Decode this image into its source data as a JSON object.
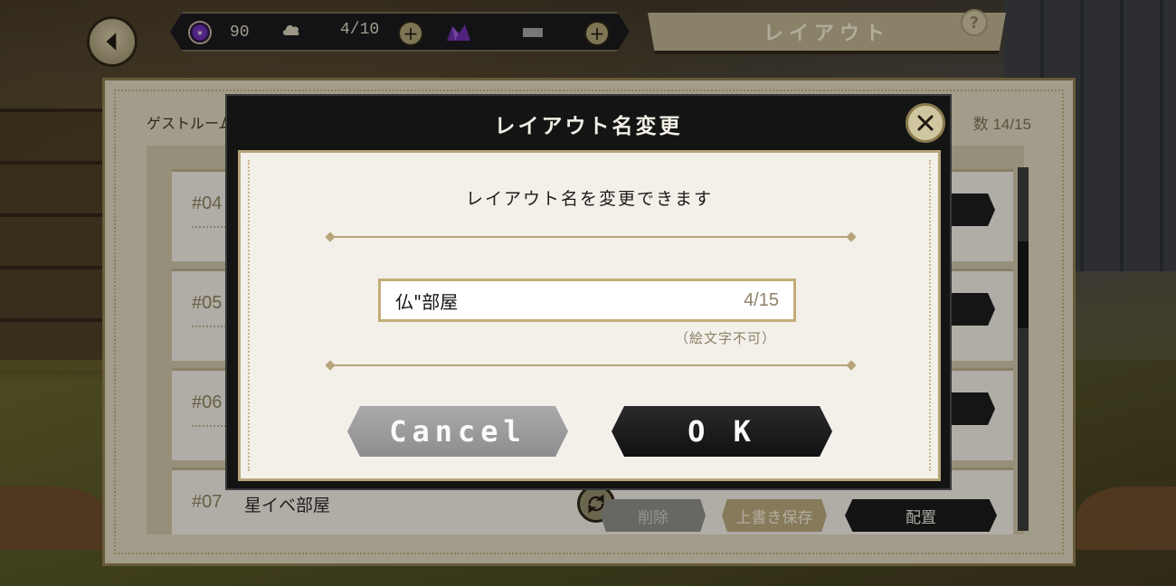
{
  "hud": {
    "gems": "90",
    "stamina": "4/10",
    "tab_title": "レイアウト",
    "help": "?"
  },
  "list_panel": {
    "guest_label": "ゲストルーム",
    "count_label": "数 14/15",
    "rows": [
      {
        "num": "#04"
      },
      {
        "num": "#05"
      },
      {
        "num": "#06"
      },
      {
        "num": "#07",
        "name": "星イベ部屋"
      }
    ],
    "row_buttons": {
      "delete": "削除",
      "overwrite": "上書き保存",
      "place": "配置"
    }
  },
  "modal": {
    "title": "レイアウト名変更",
    "subtitle": "レイアウト名を変更できます",
    "input_value": "仏\"部屋",
    "char_count": "4/15",
    "note": "（絵文字不可）",
    "cancel_label": "Cancel",
    "ok_label": "O K"
  },
  "colors": {
    "accent_gold": "#b7a47a",
    "modal_dark": "#141414",
    "panel_cream": "#f3f0ea"
  }
}
